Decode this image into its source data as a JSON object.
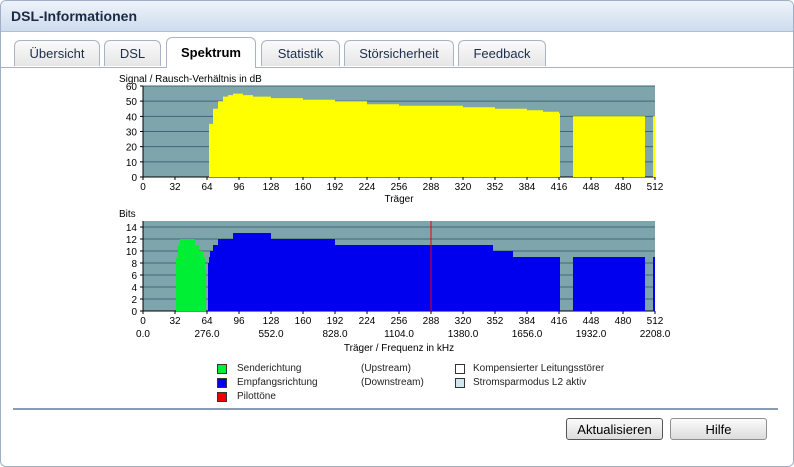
{
  "window": {
    "title": "DSL-Informationen"
  },
  "tabs": [
    {
      "label": "Übersicht",
      "active": false
    },
    {
      "label": "DSL",
      "active": false
    },
    {
      "label": "Spektrum",
      "active": true
    },
    {
      "label": "Statistik",
      "active": false
    },
    {
      "label": "Störsicherheit",
      "active": false
    },
    {
      "label": "Feedback",
      "active": false
    }
  ],
  "colors": {
    "plot_bg": "#7ea5ac",
    "grid": "#3d6a72",
    "snr": "#ffff00",
    "upstream": "#00ee33",
    "downstream": "#0000ee",
    "pilot": "#ee0000"
  },
  "chart_data": [
    {
      "type": "area",
      "title": "Signal / Rausch-Verhältnis in dB",
      "xlabel": "Träger",
      "ylabel": "",
      "xlim": [
        0,
        512
      ],
      "ylim": [
        0,
        60
      ],
      "x_ticks": [
        "0",
        "32",
        "64",
        "96",
        "128",
        "160",
        "192",
        "224",
        "256",
        "288",
        "320",
        "352",
        "384",
        "416",
        "448",
        "480",
        "512"
      ],
      "y_ticks": [
        "0",
        "10",
        "20",
        "30",
        "40",
        "50",
        "60"
      ],
      "grid": true,
      "series": [
        {
          "x": [
            64,
            66,
            70,
            75,
            80,
            85,
            90,
            100,
            110,
            128,
            160,
            192,
            224,
            256,
            288,
            320,
            352,
            384,
            400,
            416,
            417,
            429,
            430,
            448,
            480,
            500,
            502,
            509,
            510,
            512
          ],
          "values": [
            0,
            35,
            45,
            50,
            53,
            54,
            55,
            54,
            53,
            52,
            51,
            50,
            48,
            47,
            47,
            46,
            45,
            44,
            43,
            42,
            0,
            0,
            40,
            40,
            40,
            40,
            0,
            0,
            40,
            40
          ]
        }
      ]
    },
    {
      "type": "area",
      "title": "Bits",
      "xlabel": "Träger / Frequenz in kHz",
      "ylabel": "",
      "xlim": [
        0,
        512
      ],
      "ylim": [
        0,
        15
      ],
      "x_ticks": [
        "0",
        "32",
        "64",
        "96",
        "128",
        "160",
        "192",
        "224",
        "256",
        "288",
        "320",
        "352",
        "384",
        "416",
        "448",
        "480",
        "512"
      ],
      "x_ticks2": [
        "0.0",
        "276.0",
        "552.0",
        "828.0",
        "1104.0",
        "1380.0",
        "1656.0",
        "1932.0",
        "2208.0"
      ],
      "y_ticks": [
        "0",
        "2",
        "4",
        "6",
        "8",
        "10",
        "12",
        "14"
      ],
      "grid": true,
      "series": [
        {
          "name": "Senderichtung",
          "x": [
            32,
            33,
            35,
            37,
            40,
            43,
            47,
            50,
            52,
            56,
            60,
            62,
            63
          ],
          "values": [
            0,
            9,
            11,
            12,
            12,
            12,
            12,
            12,
            11,
            10,
            9,
            7,
            0
          ]
        },
        {
          "name": "Empfangsrichtung",
          "x": [
            64,
            65,
            66,
            67,
            70,
            75,
            80,
            90,
            100,
            110,
            128,
            150,
            160,
            192,
            224,
            256,
            288,
            320,
            350,
            360,
            370,
            384,
            400,
            416,
            417,
            429,
            430,
            448,
            480,
            500,
            502,
            509,
            510,
            512
          ],
          "values": [
            0,
            8,
            9,
            10,
            11,
            12,
            12,
            13,
            13,
            13,
            12,
            12,
            12,
            11,
            11,
            11,
            11,
            11,
            10,
            10,
            9,
            9,
            9,
            9,
            0,
            0,
            9,
            9,
            9,
            9,
            0,
            0,
            9,
            9
          ]
        },
        {
          "name": "Pilottöne",
          "x": [
            288
          ],
          "values": [
            15
          ]
        }
      ]
    }
  ],
  "legend": {
    "sender": "Senderichtung",
    "upstream": "(Upstream)",
    "receiver": "Empfangsrichtung",
    "downstream": "(Downstream)",
    "pilot": "Pilottöne",
    "compensated": "Kompensierter Leitungsstörer",
    "powersave": "Stromsparmodus L2 aktiv"
  },
  "buttons": {
    "refresh": "Aktualisieren",
    "help": "Hilfe"
  }
}
